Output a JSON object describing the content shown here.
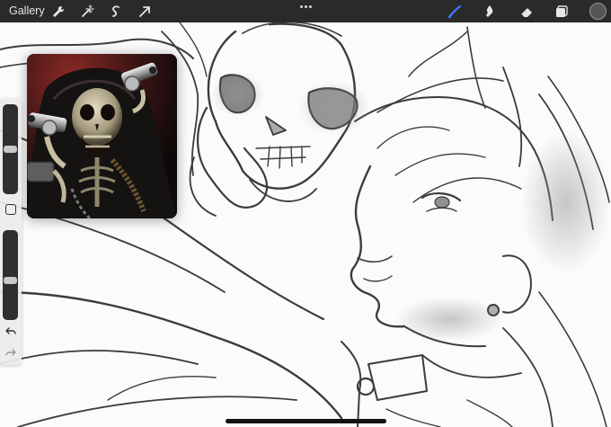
{
  "toolbar": {
    "gallery_label": "Gallery",
    "left_icons": [
      "wrench-icon",
      "magic-wand-icon",
      "selection-icon",
      "transform-arrow-icon"
    ],
    "right_icons": [
      "brush-icon",
      "smudge-icon",
      "eraser-icon",
      "layers-icon"
    ],
    "active_tool": "brush",
    "accent_color": "#3a7bff",
    "current_color": "#555555"
  },
  "sidebar": {
    "brush_size_level": 0.62,
    "opacity_level": 0.45,
    "controls": [
      "brush-size-slider",
      "modify-button",
      "opacity-slider",
      "undo-button",
      "redo-button"
    ]
  },
  "reference": {
    "visible": true,
    "subject": "skeleton-with-revolvers"
  }
}
